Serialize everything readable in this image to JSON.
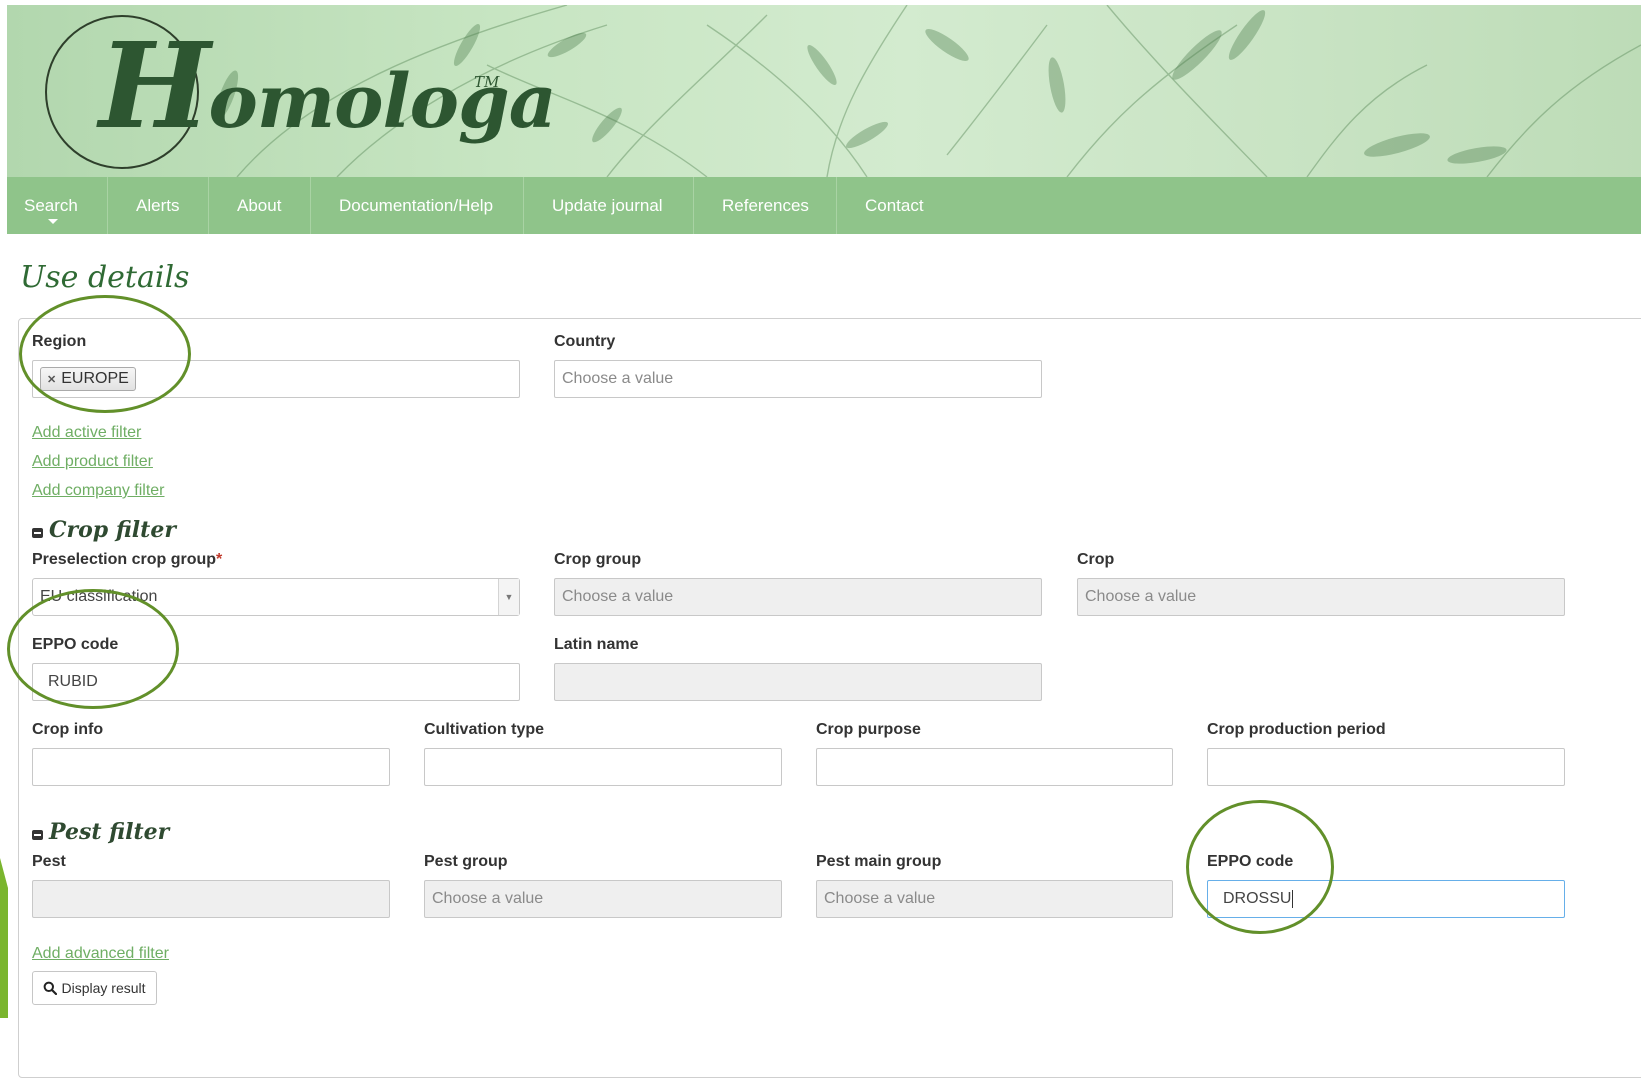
{
  "header": {
    "logo_big_letter": "H",
    "logo_rest": "omologa",
    "logo_tm": "TM"
  },
  "nav": {
    "items": [
      {
        "label": "Search"
      },
      {
        "label": "Alerts"
      },
      {
        "label": "About"
      },
      {
        "label": "Documentation/Help"
      },
      {
        "label": "Update journal"
      },
      {
        "label": "References"
      },
      {
        "label": "Contact"
      }
    ]
  },
  "page": {
    "title": "Use details"
  },
  "location": {
    "region_label": "Region",
    "region_token": "EUROPE",
    "country_label": "Country",
    "country_placeholder": "Choose a value"
  },
  "links": {
    "add_active": "Add active filter",
    "add_product": "Add product filter",
    "add_company": "Add company filter",
    "add_advanced": "Add advanced filter"
  },
  "crop_filter": {
    "heading": "Crop filter",
    "preselection_label": "Preselection crop group",
    "required_mark": "*",
    "preselection_value": "EU classification",
    "crop_group_label": "Crop group",
    "crop_group_placeholder": "Choose a value",
    "crop_label": "Crop",
    "crop_placeholder": "Choose a value",
    "eppo_label": "EPPO code",
    "eppo_value": "RUBID",
    "latin_label": "Latin name",
    "crop_info_label": "Crop info",
    "cultivation_label": "Cultivation type",
    "purpose_label": "Crop purpose",
    "period_label": "Crop production period"
  },
  "pest_filter": {
    "heading": "Pest filter",
    "pest_label": "Pest",
    "pest_group_label": "Pest group",
    "pest_group_placeholder": "Choose a value",
    "pest_main_label": "Pest main group",
    "pest_main_placeholder": "Choose a value",
    "eppo_label": "EPPO code",
    "eppo_value": "DROSSU"
  },
  "actions": {
    "display_result": "Display result"
  },
  "colors": {
    "nav_green": "#8fc48a",
    "link_green": "#6fae64",
    "annotation_green": "#62902a",
    "title_green": "#2f6a34"
  }
}
